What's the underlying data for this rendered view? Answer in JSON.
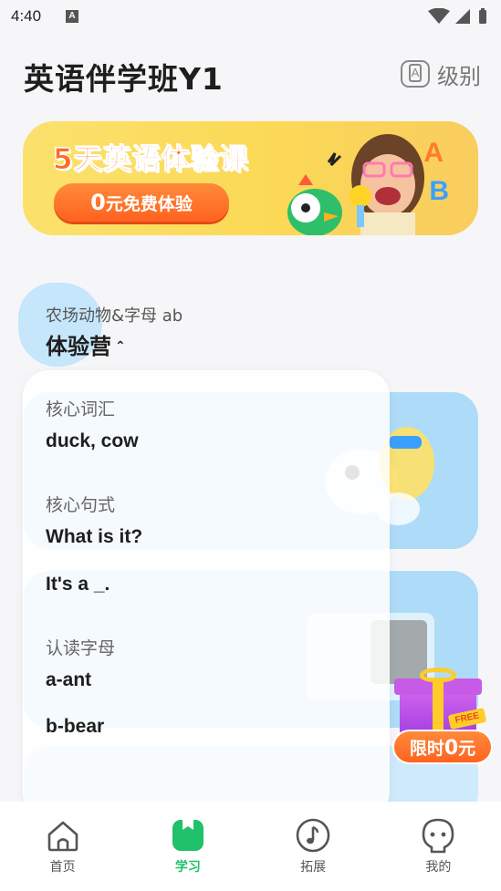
{
  "status_bar": {
    "time": "4:40",
    "notification_badge": "A"
  },
  "header": {
    "title": "英语伴学班Y1",
    "level_label": "级别",
    "level_icon": "level-a-icon"
  },
  "banner": {
    "title": "5天英语体验课",
    "cta_prefix": "0",
    "cta_text": "元免费体验",
    "letter_a": "A",
    "letter_b": "B"
  },
  "course": {
    "subtitle": "农场动物&字母 ab",
    "name": "体验营",
    "caret": "⌃"
  },
  "popup": {
    "vocab_heading": "核心词汇",
    "vocab_value": "duck, cow",
    "sentence_heading": "核心句式",
    "sentence_1": "What is it?",
    "sentence_2": "It's a _.",
    "letters_heading": "认读字母",
    "letter_1": "a-ant",
    "letter_2": "b-bear"
  },
  "promo": {
    "badge": "FREE",
    "label_prefix": "限时",
    "label_value": "0",
    "label_suffix": "元"
  },
  "tabs": [
    {
      "label": "首页",
      "icon": "home-icon",
      "active": false
    },
    {
      "label": "学习",
      "icon": "study-icon",
      "active": true
    },
    {
      "label": "拓展",
      "icon": "music-note-icon",
      "active": false
    },
    {
      "label": "我的",
      "icon": "profile-icon",
      "active": false
    }
  ],
  "colors": {
    "accent_green": "#1fc16a",
    "accent_orange": "#ff6a2a",
    "card_blue": "#aedcf8",
    "banner_yellow": "#fbd956"
  }
}
